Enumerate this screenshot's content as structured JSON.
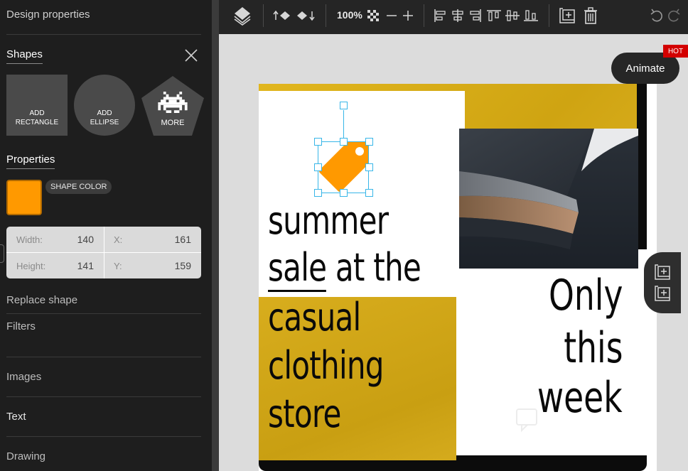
{
  "sidebar": {
    "title": "Design properties",
    "shapes_label": "Shapes",
    "shape_buttons": [
      {
        "line1": "ADD",
        "line2": "RECTANGLE"
      },
      {
        "line1": "ADD",
        "line2": "ELLIPSE"
      },
      {
        "line1": "MORE"
      }
    ],
    "properties_label": "Properties",
    "shape_color_label": "SHAPE COLOR",
    "shape_color": "#ff9900",
    "dimensions": {
      "width_label": "Width:",
      "width_value": "140",
      "x_label": "X:",
      "x_value": "161",
      "height_label": "Height:",
      "height_value": "141",
      "y_label": "Y:",
      "y_value": "159"
    },
    "replace_shape": "Replace shape",
    "filters": "Filters",
    "menu": [
      "Images",
      "Text",
      "Drawing"
    ]
  },
  "toolbar": {
    "zoom": "100%",
    "icons": [
      "layers-icon",
      "bring-forward-icon",
      "send-backward-icon",
      "opacity-icon",
      "zoom-out-icon",
      "zoom-in-icon",
      "align-left-icon",
      "align-center-icon",
      "align-right-icon",
      "align-top-icon",
      "align-middle-icon",
      "align-bottom-icon",
      "duplicate-icon",
      "delete-icon",
      "undo-icon",
      "redo-icon"
    ]
  },
  "canvas": {
    "headline_lines": [
      "summer",
      "sale",
      "at the",
      "casual",
      "clothing",
      "store"
    ],
    "right_lines": [
      "Only",
      "this",
      "week"
    ],
    "animate_label": "Animate",
    "hot_badge": "HOT",
    "accent_color": "#38b6e8",
    "yellow_color": "#d8ad1d"
  }
}
